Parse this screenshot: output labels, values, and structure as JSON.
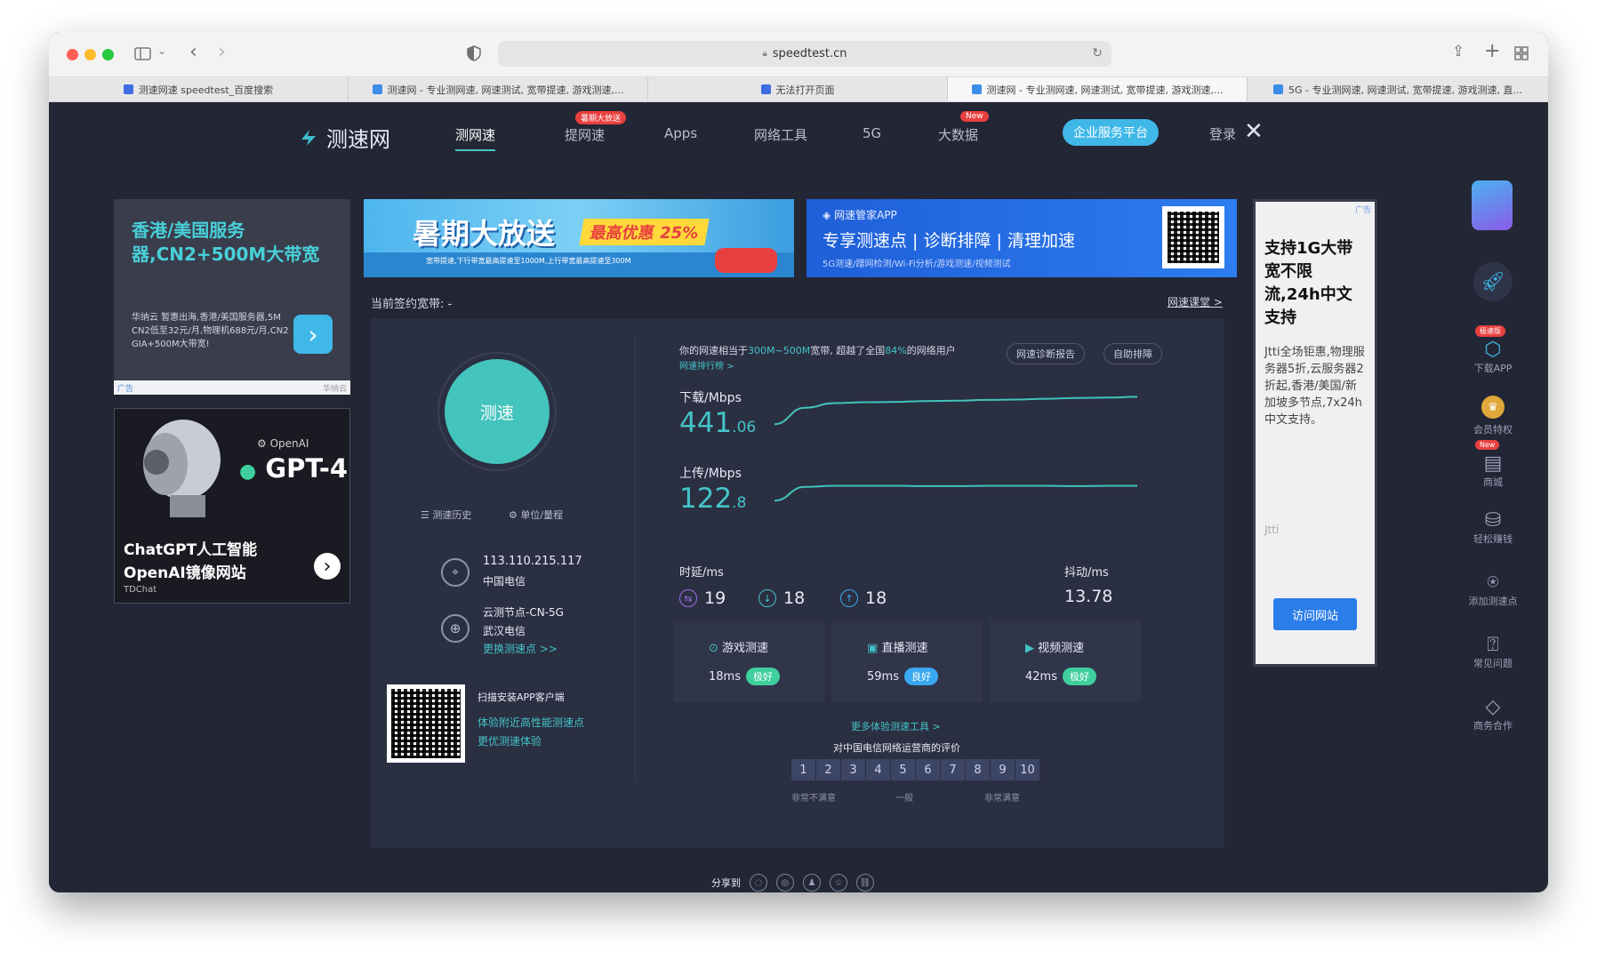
{
  "browser": {
    "url": "speedtest.cn",
    "tabs": [
      {
        "title": "测速网速 speedtest_百度搜索"
      },
      {
        "title": "测速网 - 专业测网速, 网速测试, 宽带提速, 游戏测速,..."
      },
      {
        "title": "无法打开页面"
      },
      {
        "title": "测速网 - 专业测网速, 网速测试, 宽带提速, 游戏测速,..."
      },
      {
        "title": "5G - 专业测网速, 网速测试, 宽带提速, 游戏测速, 直..."
      }
    ]
  },
  "site": {
    "logo": "测速网",
    "nav": [
      "测网速",
      "提网速",
      "Apps",
      "网络工具",
      "5G",
      "大数据"
    ],
    "nav_badge_tiwang": "暑期大放送",
    "nav_badge_new": "New",
    "enterprise": "企业服务平台",
    "login": "登录"
  },
  "ads": {
    "left1": {
      "title": "香港/美国服务器,CN2+500M大带宽",
      "text": "华纳云 暂惠出海,香港/美国服务器,5M CN2低至32元/月,物理机688元/月,CN2 GIA+500M大带宽!",
      "footer_left": "广告",
      "footer_right": "华纳云"
    },
    "left2": {
      "brand": "OpenAI",
      "model": "GPT-4",
      "title1": "ChatGPT人工智能",
      "title2": "OpenAI镜像网站",
      "foot": "TDChat"
    },
    "banner1": {
      "title": "暑期大放送",
      "badge": "最高优惠 25%",
      "sub": "宽带提速,下行带宽最高提速至1000M,上行带宽最高提速至300M"
    },
    "banner2": {
      "brand": "网速管家APP",
      "title": "专享测速点 | 诊断排障 | 清理加速",
      "sub": "5G测速/蹭网检测/Wi-Fi分析/游戏测速/视频测试"
    },
    "right": {
      "tag": "广告",
      "title": "支持1G大带宽不限流,24h中文支持",
      "text": "Jtti全场钜惠,物理服务器5折,云服务器2折起,香港/美国/新加坡多节点,7x24h中文支持。",
      "brand": "Jtti",
      "button": "访问网站"
    }
  },
  "speed": {
    "contract_label": "当前签约宽带: -",
    "class_link": "网速课堂 >",
    "start": "测速",
    "history": "测速历史",
    "units": "单位/量程",
    "ip": "113.110.215.117",
    "isp": "中国电信",
    "node": "云测节点-CN-5G",
    "node_isp": "武汉电信",
    "change_node": "更换测速点 >>",
    "qr_title": "扫描安装APP客户端",
    "qr_line1": "体验附近高性能测速点",
    "qr_line2": "更优测速体验",
    "summary_a": "你的网速相当于",
    "summary_range": "300M~500M",
    "summary_b": "宽带, 超越了全国",
    "summary_pct": "84%",
    "summary_c": "的网络用户",
    "rank_link": "网速排行榜 >",
    "report_btn": "网速诊断报告",
    "selfcheck_btn": "自助排障",
    "download_label": "下载/Mbps",
    "download_int": "441",
    "download_dec": ".06",
    "upload_label": "上传/Mbps",
    "upload_int": "122",
    "upload_dec": ".8",
    "latency_label": "时延/ms",
    "ping": "19",
    "ping_down": "18",
    "ping_up": "18",
    "jitter_label": "抖动/ms",
    "jitter": "13.78"
  },
  "tests": [
    {
      "name": "游戏测速",
      "ms": "18ms",
      "status": "极好",
      "color": "#3fcf9f"
    },
    {
      "name": "直播测速",
      "ms": "59ms",
      "status": "良好",
      "color": "#3aa8f0"
    },
    {
      "name": "视频测速",
      "ms": "42ms",
      "status": "极好",
      "color": "#3fcf9f"
    }
  ],
  "more_tools": "更多体验测速工具 >",
  "rating": {
    "title": "对中国电信网络运营商的评价",
    "scale": [
      "1",
      "2",
      "3",
      "4",
      "5",
      "6",
      "7",
      "8",
      "9",
      "10"
    ],
    "low": "非常不满意",
    "mid": "一般",
    "high": "非常满意"
  },
  "share": {
    "label": "分享到"
  },
  "sidebar": {
    "badge_speed": "极速版",
    "badge_new": "New",
    "items": [
      "下载APP",
      "会员特权",
      "商城",
      "轻松赚钱",
      "添加测速点",
      "常见问题",
      "商务合作"
    ]
  },
  "chart_data": [
    {
      "type": "line",
      "title": "下载/Mbps",
      "series": [
        {
          "values": [
            20,
            62,
            74,
            76,
            77,
            79,
            80,
            82,
            83,
            85,
            87,
            88,
            90
          ]
        }
      ]
    },
    {
      "type": "line",
      "title": "上传/Mbps",
      "series": [
        {
          "values": [
            20,
            55,
            58,
            58,
            58,
            57,
            57,
            58,
            58,
            58,
            57,
            58,
            58
          ]
        }
      ]
    }
  ]
}
